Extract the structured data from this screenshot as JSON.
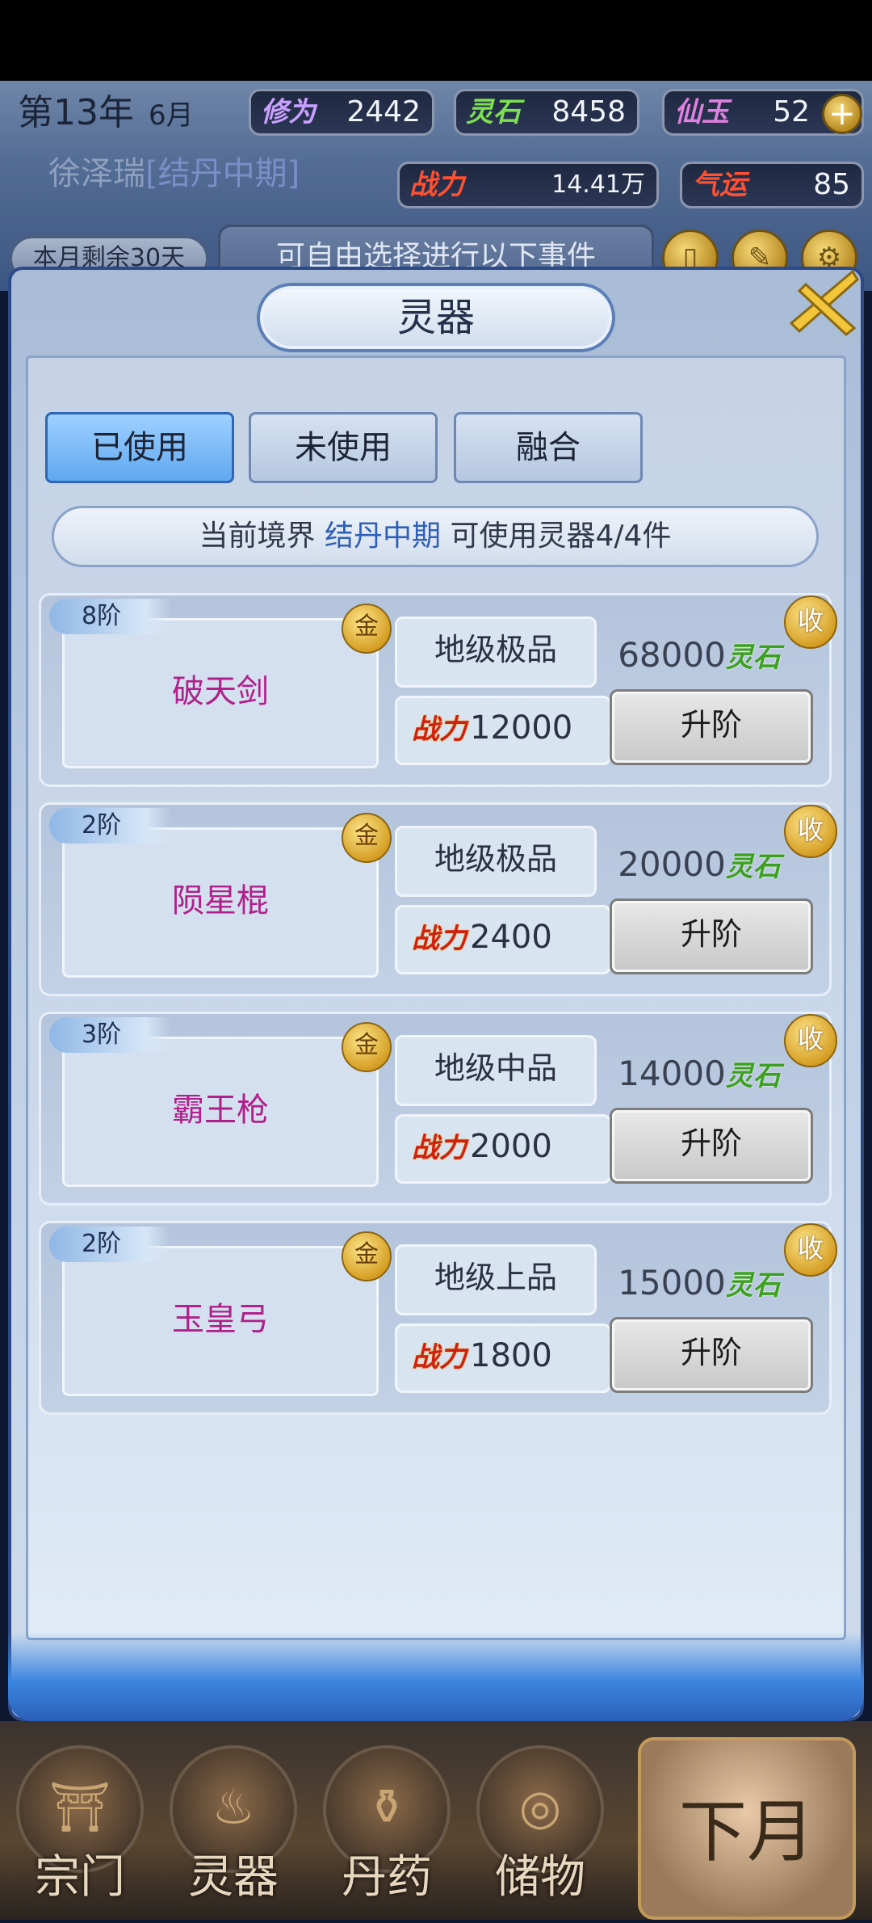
{
  "header": {
    "year": "第13年",
    "month": "6月",
    "stats": [
      {
        "label": "修为",
        "value": "2442"
      },
      {
        "label": "灵石",
        "value": "8458"
      },
      {
        "label": "仙玉",
        "value": "52"
      }
    ],
    "player_name": "徐泽瑞",
    "player_realm": "[结丹中期]",
    "power": {
      "label": "战力",
      "value": "14.41万"
    },
    "luck": {
      "label": "气运",
      "value": "85"
    },
    "days_left": "本月剩余30天",
    "event_hint": "可自由选择进行以下事件"
  },
  "dialog": {
    "title": "灵器",
    "tabs": [
      "已使用",
      "未使用",
      "融合"
    ],
    "active_tab": 0,
    "realm_info": {
      "prefix": "当前境界",
      "realm": "结丹中期",
      "suffix": "可使用灵器4/4件"
    },
    "power_label": "战力",
    "stone_label": "灵石",
    "upgrade_label": "升阶",
    "collect_label": "收",
    "gold_label": "金",
    "items": [
      {
        "tier": "8阶",
        "name": "破天剑",
        "grade": "地级极品",
        "power": "12000",
        "cost": "68000"
      },
      {
        "tier": "2阶",
        "name": "陨星棍",
        "grade": "地级极品",
        "power": "2400",
        "cost": "20000"
      },
      {
        "tier": "3阶",
        "name": "霸王枪",
        "grade": "地级中品",
        "power": "2000",
        "cost": "14000"
      },
      {
        "tier": "2阶",
        "name": "玉皇弓",
        "grade": "地级上品",
        "power": "1800",
        "cost": "15000"
      }
    ]
  },
  "bottom_nav": {
    "items": [
      "宗门",
      "灵器",
      "丹药",
      "储物"
    ],
    "next_month": "下月"
  },
  "colors": {
    "item_name": "#b0208a",
    "realm_blue": "#2f5fb8",
    "active_tab": "#5fa8f0"
  }
}
